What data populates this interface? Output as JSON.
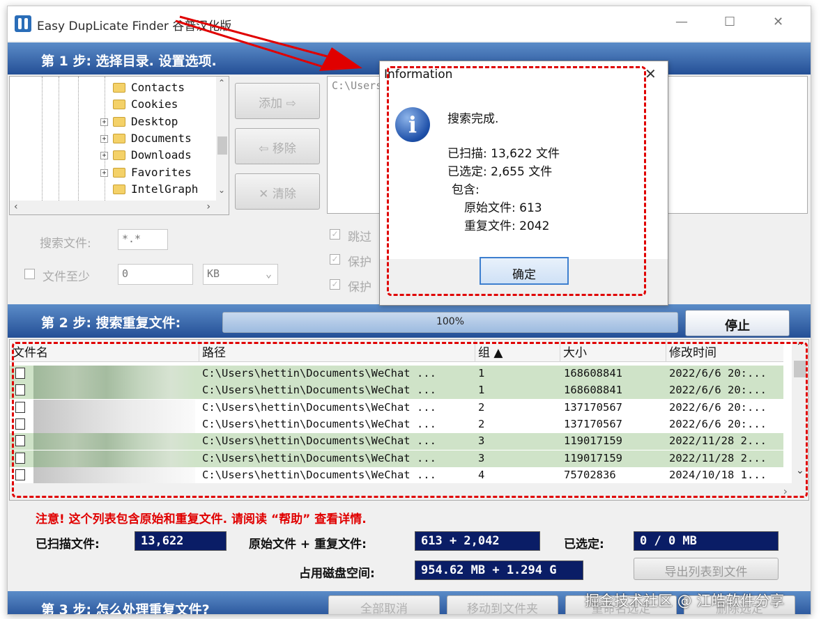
{
  "window": {
    "title": "Easy DupLicate Finder 谷普汉化版",
    "minimize": "—",
    "maximize": "☐",
    "close": "✕"
  },
  "step1": {
    "title": "第 1 步: 选择目录. 设置选项."
  },
  "tree": {
    "items": [
      {
        "label": "Contacts",
        "expander": false
      },
      {
        "label": "Cookies",
        "expander": false
      },
      {
        "label": "Desktop",
        "expander": true
      },
      {
        "label": "Documents",
        "expander": true
      },
      {
        "label": "Downloads",
        "expander": true
      },
      {
        "label": "Favorites",
        "expander": true
      },
      {
        "label": "IntelGraph",
        "expander": false
      }
    ]
  },
  "buttons": {
    "add": "添加 ⇨",
    "remove": "⇦ 移除",
    "clear": "✕ 清除"
  },
  "paths": [
    "C:\\Users"
  ],
  "options": {
    "search_label": "搜索文件:",
    "search_value": "*.*",
    "min_size_label": "文件至少",
    "min_size_value": "0",
    "unit": "KB",
    "checks": [
      "跳过",
      "保护",
      "保护"
    ]
  },
  "step2": {
    "title": "第 2 步: 搜索重复文件:",
    "progress_text": "100%",
    "progress": 1.0,
    "stop_button": "停止"
  },
  "grid": {
    "columns": [
      "文件名",
      "路径",
      "组 ▲",
      "大小",
      "修改时间"
    ],
    "rows": [
      {
        "path": "C:\\Users\\hettin\\Documents\\WeChat ...",
        "group": "1",
        "size": "168608841",
        "modified": "2022/6/6 20:...",
        "green": true
      },
      {
        "path": "C:\\Users\\hettin\\Documents\\WeChat ...",
        "group": "1",
        "size": "168608841",
        "modified": "2022/6/6 20:...",
        "green": true
      },
      {
        "path": "C:\\Users\\hettin\\Documents\\WeChat ...",
        "group": "2",
        "size": "137170567",
        "modified": "2022/6/6 20:...",
        "green": false
      },
      {
        "path": "C:\\Users\\hettin\\Documents\\WeChat ...",
        "group": "2",
        "size": "137170567",
        "modified": "2022/6/6 20:...",
        "green": false
      },
      {
        "path": "C:\\Users\\hettin\\Documents\\WeChat ...",
        "group": "3",
        "size": "119017159",
        "modified": "2022/11/28 2...",
        "green": true
      },
      {
        "path": "C:\\Users\\hettin\\Documents\\WeChat ...",
        "group": "3",
        "size": "119017159",
        "modified": "2022/11/28 2...",
        "green": true
      },
      {
        "path": "C:\\Users\\hettin\\Documents\\WeChat ...",
        "group": "4",
        "size": "75702836",
        "modified": "2024/10/18 1...",
        "green": false
      }
    ]
  },
  "footer": {
    "note": "注意! 这个列表包含原始和重复文件. 请阅读 “帮助” 查看详情.",
    "scanned_label": "已扫描文件:",
    "scanned_value": "13,622",
    "orig_dup_label": "原始文件 + 重复文件:",
    "orig_dup_value": "613 + 2,042",
    "selected_label": "已选定:",
    "selected_value": "0 / 0 MB",
    "disk_label": "占用磁盘空间:",
    "disk_value": "954.62 MB + 1.294 G",
    "export_button": "导出列表到文件"
  },
  "step3": {
    "title": "第 3 步: 怎么处理重复文件?",
    "buttons": [
      "全部取消",
      "移动到文件夹",
      "重命名选定",
      "删除选定"
    ]
  },
  "dialog": {
    "title": "Information",
    "close": "✕",
    "icon": "i",
    "line1": "搜索完成.",
    "line2": "已扫描: 13,622 文件",
    "line3": "已选定: 2,655 文件",
    "line4": "包含:",
    "line5": "原始文件: 613",
    "line6": "重复文件: 2042",
    "ok_button": "确定"
  },
  "watermark": "掘金技术社区 @ 江皓软件分享",
  "colors": {
    "highlight_red": "#e00000",
    "step_bar": "#244f96",
    "stat_bg": "#0a1d66",
    "group_green": "#cfe3c8"
  }
}
